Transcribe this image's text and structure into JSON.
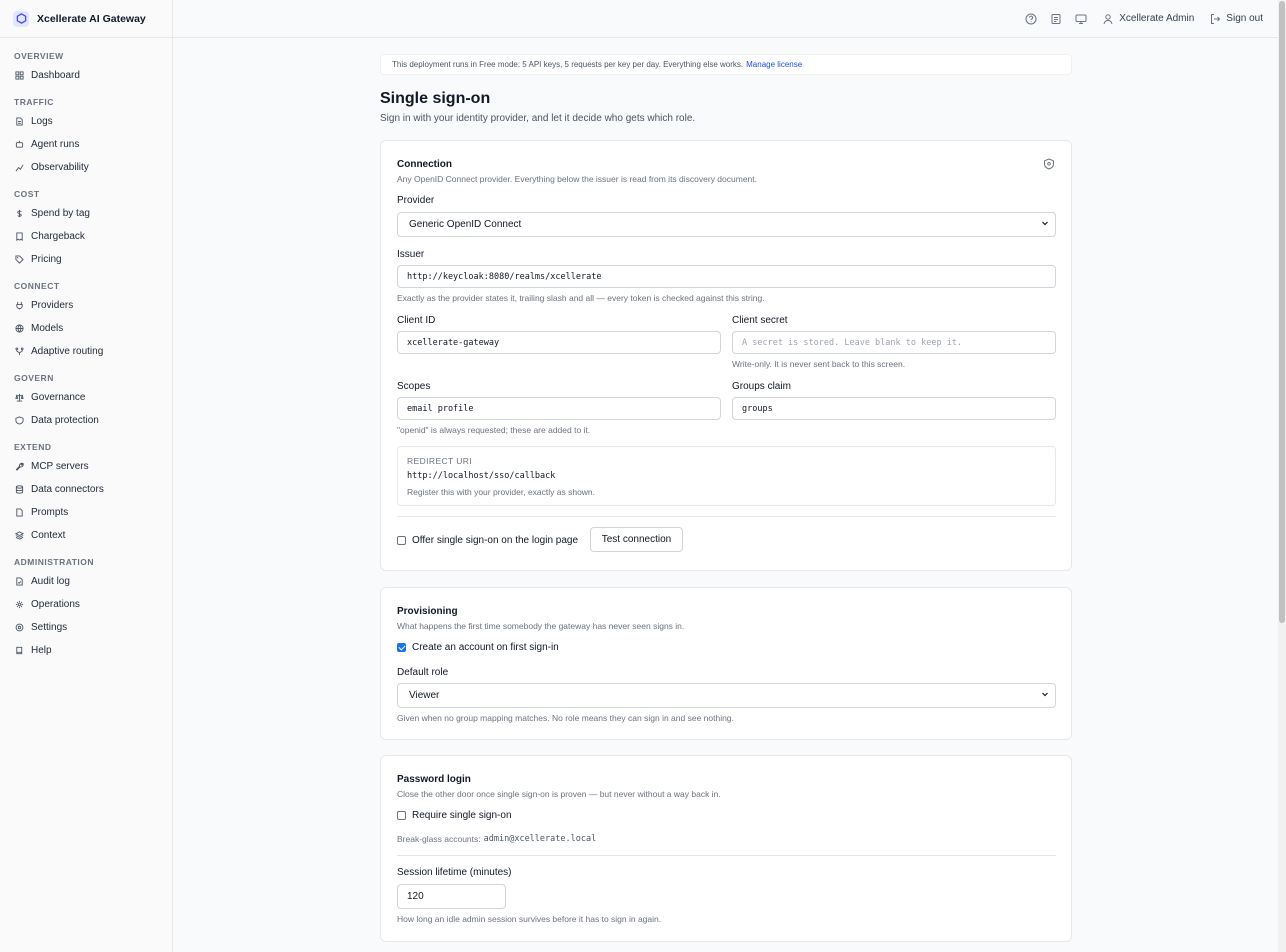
{
  "app": {
    "name": "Xcellerate AI Gateway"
  },
  "sidebar": {
    "sections": [
      {
        "title": "OVERVIEW",
        "items": [
          {
            "label": "Dashboard",
            "icon": "dashboard-icon"
          }
        ]
      },
      {
        "title": "TRAFFIC",
        "items": [
          {
            "label": "Logs",
            "icon": "file-text-icon"
          },
          {
            "label": "Agent runs",
            "icon": "bot-icon"
          },
          {
            "label": "Observability",
            "icon": "line-chart-icon"
          }
        ]
      },
      {
        "title": "COST",
        "items": [
          {
            "label": "Spend by tag",
            "icon": "dollar-icon"
          },
          {
            "label": "Chargeback",
            "icon": "receipt-icon"
          },
          {
            "label": "Pricing",
            "icon": "tag-icon"
          }
        ]
      },
      {
        "title": "CONNECT",
        "items": [
          {
            "label": "Providers",
            "icon": "plug-icon"
          },
          {
            "label": "Models",
            "icon": "globe-icon"
          },
          {
            "label": "Adaptive routing",
            "icon": "route-icon"
          }
        ]
      },
      {
        "title": "GOVERN",
        "items": [
          {
            "label": "Governance",
            "icon": "scale-icon"
          },
          {
            "label": "Data protection",
            "icon": "shield-icon"
          }
        ]
      },
      {
        "title": "EXTEND",
        "items": [
          {
            "label": "MCP servers",
            "icon": "wrench-icon"
          },
          {
            "label": "Data connectors",
            "icon": "database-icon"
          },
          {
            "label": "Prompts",
            "icon": "document-icon"
          },
          {
            "label": "Context",
            "icon": "layers-icon"
          }
        ]
      },
      {
        "title": "ADMINISTRATION",
        "items": [
          {
            "label": "Audit log",
            "icon": "audit-icon"
          },
          {
            "label": "Operations",
            "icon": "gear-icon"
          },
          {
            "label": "Settings",
            "icon": "settings-icon"
          },
          {
            "label": "Help",
            "icon": "book-icon"
          }
        ]
      }
    ]
  },
  "topbar": {
    "user_name": "Xcellerate Admin",
    "sign_out": "Sign out"
  },
  "banner": {
    "text": "This deployment runs in Free mode: 5 API keys, 5 requests per key per day. Everything else works.",
    "link": "Manage license"
  },
  "page": {
    "title": "Single sign-on",
    "subtitle": "Sign in with your identity provider, and let it decide who gets which role."
  },
  "connection": {
    "title": "Connection",
    "desc": "Any OpenID Connect provider. Everything below the issuer is read from its discovery document.",
    "provider_label": "Provider",
    "provider_value": "Generic OpenID Connect",
    "issuer_label": "Issuer",
    "issuer_value": "http://keycloak:8080/realms/xcellerate",
    "issuer_help": "Exactly as the provider states it, trailing slash and all — every token is checked against this string.",
    "client_id_label": "Client ID",
    "client_id_value": "xcellerate-gateway",
    "client_secret_label": "Client secret",
    "client_secret_placeholder": "A secret is stored. Leave blank to keep it.",
    "client_secret_help": "Write-only. It is never sent back to this screen.",
    "scopes_label": "Scopes",
    "scopes_value": "email profile",
    "scopes_help": "\"openid\" is always requested; these are added to it.",
    "groups_label": "Groups claim",
    "groups_value": "groups",
    "redirect_label": "REDIRECT URI",
    "redirect_value": "http://localhost/sso/callback",
    "redirect_help": "Register this with your provider, exactly as shown.",
    "offer_sso_label": "Offer single sign-on on the login page",
    "offer_sso_checked": false,
    "test_button": "Test connection"
  },
  "provisioning": {
    "title": "Provisioning",
    "desc": "What happens the first time somebody the gateway has never seen signs in.",
    "create_account_label": "Create an account on first sign-in",
    "create_account_checked": true,
    "default_role_label": "Default role",
    "default_role_value": "Viewer",
    "default_role_help": "Given when no group mapping matches. No role means they can sign in and see nothing."
  },
  "password_login": {
    "title": "Password login",
    "desc": "Close the other door once single sign-on is proven — but never without a way back in.",
    "require_sso_label": "Require single sign-on",
    "require_sso_checked": false,
    "break_glass_prefix": "Break-glass accounts:",
    "break_glass_value": "admin@xcellerate.local",
    "session_label": "Session lifetime (minutes)",
    "session_value": "120",
    "session_help": "How long an idle admin session survives before it has to sign in again."
  },
  "colors": {
    "accent": "#1a73e8",
    "link": "#1d4ed8",
    "border": "#e5e7eb"
  }
}
